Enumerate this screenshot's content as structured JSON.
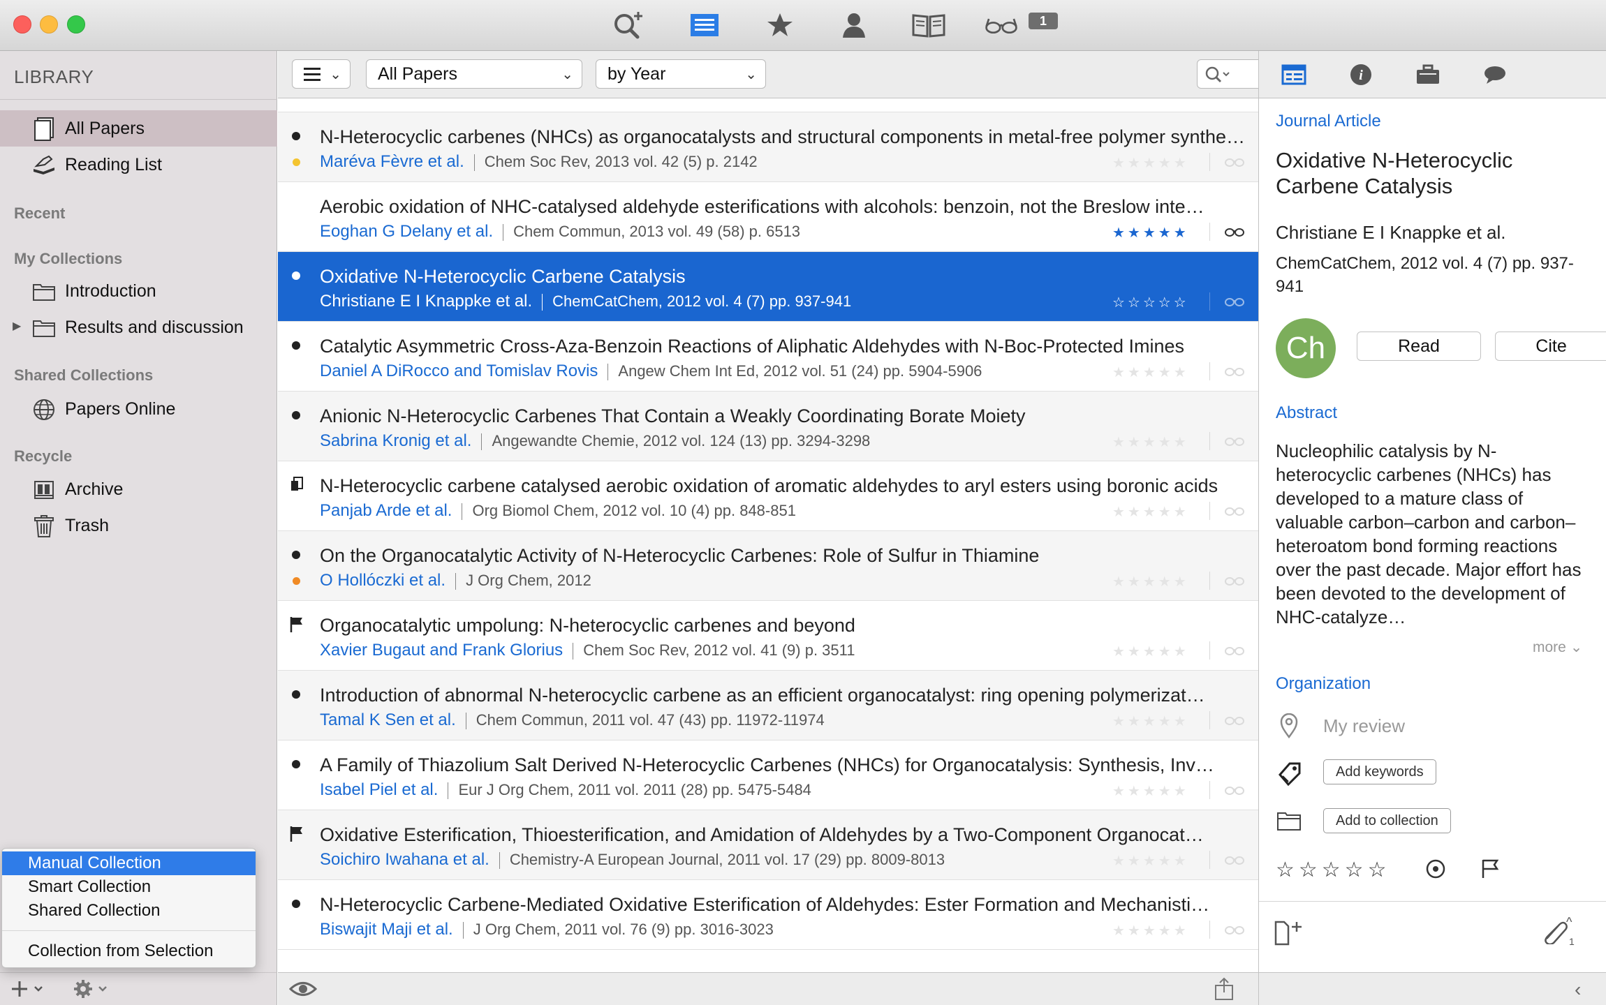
{
  "toolbar": {
    "badge_count": "1"
  },
  "sidebar": {
    "header": "LIBRARY",
    "items": [
      {
        "label": "All Papers"
      },
      {
        "label": "Reading List"
      }
    ],
    "recent_label": "Recent",
    "my_collections_label": "My Collections",
    "my_collections": [
      {
        "label": "Introduction"
      },
      {
        "label": "Results and discussion"
      }
    ],
    "shared_label": "Shared Collections",
    "shared": [
      {
        "label": "Papers Online"
      }
    ],
    "recycle_label": "Recycle",
    "recycle": [
      {
        "label": "Archive"
      },
      {
        "label": "Trash"
      }
    ]
  },
  "popup_menu": {
    "items": [
      "Manual Collection",
      "Smart Collection",
      "Shared Collection",
      "Collection from Selection"
    ]
  },
  "filterbar": {
    "papers_select": "All Papers",
    "group_select": "by Year",
    "search_placeholder": ""
  },
  "papers": [
    {
      "title": "N-Heterocyclic carbenes (NHCs) as organocatalysts and structural components in metal-free polymer synthesis",
      "authors": "Maréva Fèvre et al.",
      "meta": "Chem Soc Rev, 2013 vol. 42 (5) p. 2142",
      "rating": 0,
      "status_color": "#f4c430"
    },
    {
      "title": "Aerobic oxidation of NHC-catalysed aldehyde esterifications with alcohols: benzoin, not the Breslow inte…",
      "authors": "Eoghan G Delany et al.",
      "meta": "Chem Commun, 2013 vol. 49 (58) p. 6513",
      "rating": 5
    },
    {
      "title": "Oxidative N-Heterocyclic Carbene Catalysis",
      "authors": "Christiane E I Knappke et al.",
      "meta": "ChemCatChem, 2012 vol. 4 (7) pp. 937-941",
      "rating": 0
    },
    {
      "title": "Catalytic Asymmetric Cross-Aza-Benzoin Reactions of Aliphatic Aldehydes with N-Boc-Protected Imines",
      "authors": "Daniel A DiRocco and Tomislav Rovis",
      "meta": "Angew Chem Int Ed, 2012 vol. 51 (24) pp. 5904-5906",
      "rating": 0
    },
    {
      "title": "Anionic N-Heterocyclic Carbenes That Contain a Weakly Coordinating Borate Moiety",
      "authors": "Sabrina Kronig et al.",
      "meta": "Angewandte Chemie, 2012 vol. 124 (13) pp. 3294-3298",
      "rating": 0
    },
    {
      "title": "N-Heterocyclic carbene catalysed aerobic oxidation of aromatic aldehydes to aryl esters using boronic acids",
      "authors": "Panjab Arde et al.",
      "meta": "Org Biomol Chem, 2012 vol. 10 (4) pp. 848-851",
      "rating": 0
    },
    {
      "title": "On the Organocatalytic Activity of N-Heterocyclic Carbenes: Role of Sulfur in Thiamine",
      "authors": "O Hollóczki et al.",
      "meta": "J Org Chem, 2012",
      "rating": 0,
      "status_color": "#f08a24"
    },
    {
      "title": "Organocatalytic umpolung: N-heterocyclic carbenes and beyond",
      "authors": "Xavier Bugaut and Frank Glorius",
      "meta": "Chem Soc Rev, 2012 vol. 41 (9) p. 3511",
      "rating": 0
    },
    {
      "title": "Introduction of abnormal N-heterocyclic carbene as an efficient organocatalyst: ring opening polymerizat…",
      "authors": "Tamal K Sen et al.",
      "meta": "Chem Commun, 2011 vol. 47 (43) pp. 11972-11974",
      "rating": 0
    },
    {
      "title": "A Family of Thiazolium Salt Derived N-Heterocyclic Carbenes (NHCs) for Organocatalysis: Synthesis, Inv…",
      "authors": "Isabel Piel et al.",
      "meta": "Eur J Org Chem, 2011 vol. 2011 (28) pp. 5475-5484",
      "rating": 0
    },
    {
      "title": "Oxidative Esterification, Thioesterification, and Amidation of Aldehydes by a Two-Component Organocat…",
      "authors": "Soichiro Iwahana et al.",
      "meta": "Chemistry-A European Journal, 2011 vol. 17 (29) pp. 8009-8013",
      "rating": 0
    },
    {
      "title": "N-Heterocyclic Carbene-Mediated Oxidative Esterification of Aldehydes: Ester Formation and Mechanisti…",
      "authors": "Biswajit Maji et al.",
      "meta": "J Org Chem, 2011 vol. 76 (9) pp. 3016-3023",
      "rating": 0
    }
  ],
  "details": {
    "type": "Journal Article",
    "title": "Oxidative N-Heterocyclic Carbene Catalysis",
    "authors": "Christiane E I Knappke et al.",
    "publication": "ChemCatChem, 2012 vol. 4 (7) pp. 937-941",
    "avatar": "Ch",
    "read_button": "Read",
    "cite_button": "Cite",
    "abstract_label": "Abstract",
    "abstract": "Nucleophilic catalysis by N-heterocyclic carbenes (NHCs) has developed to a mature class of valuable carbon–carbon and carbon–heteroatom bond forming reactions over the past decade. Major effort has been devoted to the development of NHC-catalyze…",
    "more": "more",
    "organization_label": "Organization",
    "review_placeholder": "My review",
    "add_keywords": "Add keywords",
    "add_collection": "Add to collection",
    "attachment_count": "1"
  },
  "colors": {
    "accent": "#1a66d0",
    "selection": "#1a66d0",
    "link": "#1a6ad2"
  }
}
